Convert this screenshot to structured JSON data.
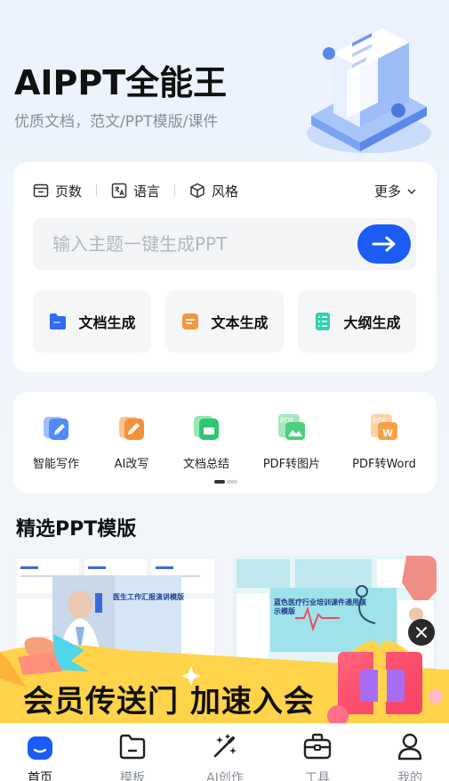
{
  "hero": {
    "title": "AIPPT全能王",
    "subtitle": "优质文档，范文/PPT模版/课件"
  },
  "generator": {
    "options": [
      {
        "label": "页数",
        "icon": "pages-icon"
      },
      {
        "label": "语言",
        "icon": "language-icon"
      },
      {
        "label": "风格",
        "icon": "style-cube-icon"
      }
    ],
    "more_label": "更多",
    "input_placeholder": "输入主题一键生成PPT",
    "buttons": [
      {
        "label": "文档生成",
        "icon": "document-folder-icon",
        "color": "#2f6bf5"
      },
      {
        "label": "文本生成",
        "icon": "text-doc-icon",
        "color": "#f7953a"
      },
      {
        "label": "大纲生成",
        "icon": "outline-list-icon",
        "color": "#2ed3b0"
      }
    ]
  },
  "tools": [
    {
      "label": "智能写作",
      "icon": "smart-write-icon",
      "color": "#4f8cf7"
    },
    {
      "label": "AI改写",
      "icon": "ai-rewrite-icon",
      "color": "#f6913b"
    },
    {
      "label": "文档总结",
      "icon": "doc-summary-icon",
      "color": "#2ec774"
    },
    {
      "label": "PDF转图片",
      "icon": "pdf-to-image-icon",
      "color": "#4cd07d"
    },
    {
      "label": "PDF转Word",
      "icon": "pdf-to-word-icon",
      "color": "#f7a04a"
    }
  ],
  "section_title": "精选PPT模版",
  "templates": [
    {
      "title": "医生工作汇报演讲模版"
    },
    {
      "title": "蓝色医疗行业培训课件通用演示模版"
    }
  ],
  "banner": {
    "text": "会员传送门 加速入会"
  },
  "tabbar": [
    {
      "label": "首页",
      "icon": "home-icon",
      "active": true
    },
    {
      "label": "模板",
      "icon": "template-folder-icon",
      "active": false
    },
    {
      "label": "AI创作",
      "icon": "ai-create-wand-icon",
      "active": false
    },
    {
      "label": "工具",
      "icon": "toolbox-icon",
      "active": false
    },
    {
      "label": "我的",
      "icon": "profile-icon",
      "active": false
    }
  ],
  "colors": {
    "accent": "#1a5cf4",
    "background": "#f3f5f9",
    "banner_yellow": "#ffd34a"
  }
}
